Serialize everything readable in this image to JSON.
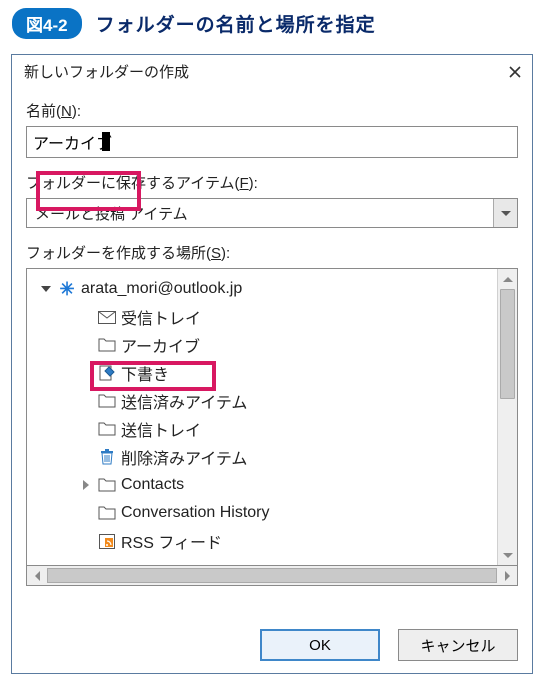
{
  "caption": {
    "badge": "図4-2",
    "title": "フォルダーの名前と場所を指定"
  },
  "dialog": {
    "title": "新しいフォルダーの作成",
    "name_label_pre": "名前(",
    "name_label_key": "N",
    "name_label_post": "):",
    "name_value": "アーカイブ",
    "contains_label_pre": "フォルダーに保存するアイテム(",
    "contains_label_key": "F",
    "contains_label_post": "):",
    "contains_value": "メールと投稿 アイテム",
    "location_label_pre": "フォルダーを作成する場所(",
    "location_label_key": "S",
    "location_label_post": "):",
    "ok": "OK",
    "cancel": "キャンセル"
  },
  "tree": {
    "account": "arata_mori@outlook.jp",
    "items": [
      {
        "label": "受信トレイ",
        "icon": "mail",
        "expander": "none"
      },
      {
        "label": "アーカイブ",
        "icon": "folder",
        "expander": "none"
      },
      {
        "label": "下書き",
        "icon": "draft",
        "expander": "none"
      },
      {
        "label": "送信済みアイテム",
        "icon": "folder",
        "expander": "none"
      },
      {
        "label": "送信トレイ",
        "icon": "folder",
        "expander": "none"
      },
      {
        "label": "削除済みアイテム",
        "icon": "trash",
        "expander": "none"
      },
      {
        "label": "Contacts",
        "icon": "folder",
        "expander": "closed"
      },
      {
        "label": "Conversation History",
        "icon": "folder",
        "expander": "none"
      },
      {
        "label": "RSS フィード",
        "icon": "rss",
        "expander": "none"
      }
    ]
  }
}
